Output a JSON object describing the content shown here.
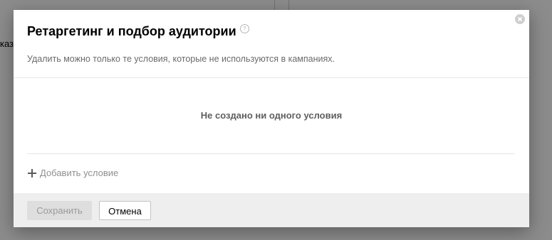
{
  "background": {
    "partial_text": "каз"
  },
  "modal": {
    "title": "Ретаргетинг и подбор аудитории",
    "help_icon": "question-circle-icon",
    "help_glyph": "?",
    "subtitle": "Удалить можно только те условия, которые не используются в кампаниях.",
    "empty_message": "Не создано ни одного условия",
    "add_condition_label": "Добавить условие",
    "close_icon": "close-circle-icon"
  },
  "footer": {
    "save_label": "Сохранить",
    "cancel_label": "Отмена"
  },
  "colors": {
    "overlay": "#8a8a8a",
    "footer_bg": "#eeeeee",
    "save_disabled_bg": "#dedede",
    "muted_text": "#6b6b6b"
  }
}
